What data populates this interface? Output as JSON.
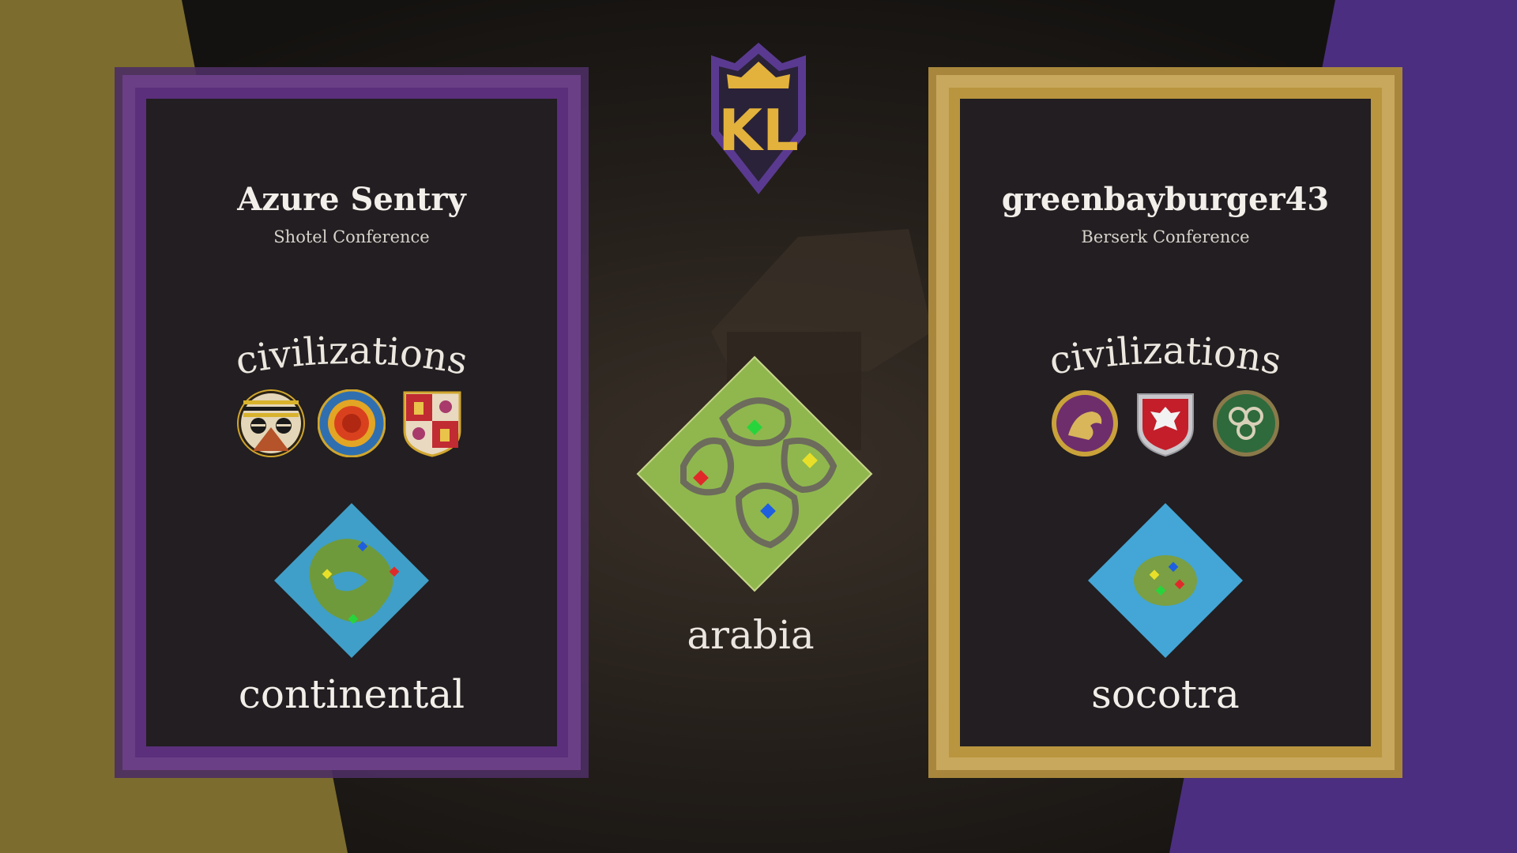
{
  "colors": {
    "left_accent": "#7c5aa8",
    "right_accent": "#d4b65c",
    "left_bg_stripe": "#7c6c2e",
    "right_bg_stripe": "#4b2e80",
    "card_bg": "#221e21"
  },
  "logo": {
    "text": "KL"
  },
  "left_player": {
    "name": "Azure Sentry",
    "conference": "Shotel Conference",
    "civ_heading": "civilizations",
    "civ_icons": [
      "ethiopians-icon",
      "incas-icon",
      "spanish-icon"
    ],
    "map_name": "continental"
  },
  "right_player": {
    "name": "greenbayburger43",
    "conference": "Berserk Conference",
    "civ_heading": "civilizations",
    "civ_icons": [
      "persians-icon",
      "poles-icon",
      "celts-icon"
    ],
    "map_name": "socotra"
  },
  "center": {
    "map_name": "arabia"
  }
}
